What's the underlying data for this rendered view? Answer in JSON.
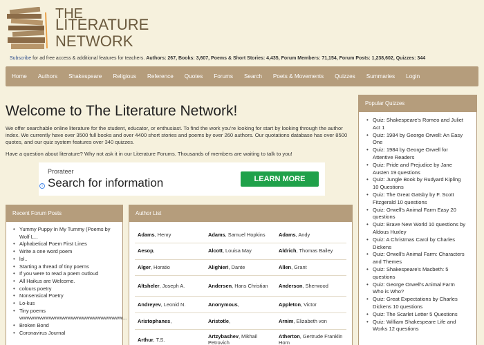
{
  "logo": {
    "line1": "THE",
    "line2": "LITERATURE",
    "line3": "NETWORK"
  },
  "stats": {
    "subscribe_link": "Subscribe",
    "subscribe_text": " for ad free access & additional features for teachers.",
    "summary": "Authors: 267, Books: 3,607, Poems & Short Stories: 4,435, Forum Members: 71,154, Forum Posts: 1,238,602, Quizzes: 344"
  },
  "nav": [
    "Home",
    "Authors",
    "Shakespeare",
    "Religious",
    "Reference",
    "Quotes",
    "Forums",
    "Search",
    "Poets & Movements",
    "Quizzes",
    "Summaries",
    "Login"
  ],
  "main": {
    "title": "Welcome to The Literature Network!",
    "intro": "We offer searchable online literature for the student, educator, or enthusiast. To find the work you're looking for start by looking through the author index. We currently have over 3500 full books and over 4400 short stories and poems by over 260 authors. Our quotations database has over 8500 quotes, and our quiz system features over 340 quizzes.",
    "question": "Have a question about literature? Why not ask it in our Literature Forums. Thousands of members are waiting to talk to you!"
  },
  "ad": {
    "brand": "Prorateer",
    "title": "Search for information",
    "button": "LEARN MORE",
    "info": "i"
  },
  "forum": {
    "heading": "Recent Forum Posts",
    "items": [
      "Yummy Puppy In My Tummy (Poems by",
      "Wolf L...",
      "Alphabetical Poem First Lines",
      "Write a one word poem",
      "lol..",
      "Starting a thread of tiny poems",
      "If you were to read a poem outloud",
      "All Haikus are Welcome.",
      "colours poetry",
      "Nonsensical Poetry",
      "Lo-kus",
      "Tiny poems",
      "wwwwwwwwwwwwwwwwwwwwwwwwwwww...",
      "Broken Bond",
      "Coronavirus Journal"
    ]
  },
  "authors": {
    "heading": "Author List",
    "rows": [
      [
        {
          "last": "Adams",
          "first": ", Henry"
        },
        {
          "last": "Adams",
          "first": ", Samuel Hopkins"
        },
        {
          "last": "Adams",
          "first": ", Andy"
        }
      ],
      [
        {
          "last": "Aesop",
          "first": ","
        },
        {
          "last": "Alcott",
          "first": ", Louisa May"
        },
        {
          "last": "Aldrich",
          "first": ", Thomas Bailey"
        }
      ],
      [
        {
          "last": "Alger",
          "first": ", Horatio"
        },
        {
          "last": "Alighieri",
          "first": ", Dante"
        },
        {
          "last": "Allen",
          "first": ", Grant"
        }
      ],
      [
        {
          "last": "Altsheler",
          "first": ", Joseph A."
        },
        {
          "last": "Andersen",
          "first": ", Hans Christian"
        },
        {
          "last": "Anderson",
          "first": ", Sherwood"
        }
      ],
      [
        {
          "last": "Andreyev",
          "first": ", Leonid N."
        },
        {
          "last": "Anonymous",
          "first": ","
        },
        {
          "last": "Appleton",
          "first": ", Victor"
        }
      ],
      [
        {
          "last": "Aristophanes",
          "first": ","
        },
        {
          "last": "Aristotle",
          "first": ","
        },
        {
          "last": "Arnim",
          "first": ", Elizabeth von"
        }
      ],
      [
        {
          "last": "Arthur",
          "first": ", T.S."
        },
        {
          "last": "Artzybashev",
          "first": ", Mikhail Petrovich"
        },
        {
          "last": "Atherton",
          "first": ", Gertrude Franklin Horn"
        }
      ]
    ]
  },
  "quizzes": {
    "heading": "Popular Quizzes",
    "items": [
      "Quiz: Shakespeare's Romeo and Juliet",
      "Act 1",
      "Quiz: 1984 by George Orwell: An Easy",
      "One",
      "Quiz: 1984 by George Orwell for",
      "Attentive Readers",
      "Quiz: Pride and Prejudice by Jane",
      "Austen 19 questions",
      "Quiz: Jungle Book by Rudyard Kipling",
      "10 Questions",
      "Quiz: The Great Gatsby by F. Scott",
      "Fitzgerald 10 questions",
      "Quiz: Orwell's Animal Farm Easy 20",
      "questions",
      "Quiz: Brave New World 10 questions by",
      "Aldous Huxley",
      "Quiz: A Christmas Carol by Charles",
      "Dickens",
      "Quiz: Orwell's Animal Farm: Characters",
      "and Themes",
      "Quiz: Shakespeare's Macbeth: 5",
      "questions",
      "Quiz: George Orwell's Animal Farm",
      "Who is Who?",
      "Quiz: Great Expectations by Charles",
      "Dickens 10 questions",
      "Quiz: The Scarlet Letter 5 Questions",
      "Quiz: William Shakespeare Life and",
      "Works 12 questions"
    ]
  }
}
